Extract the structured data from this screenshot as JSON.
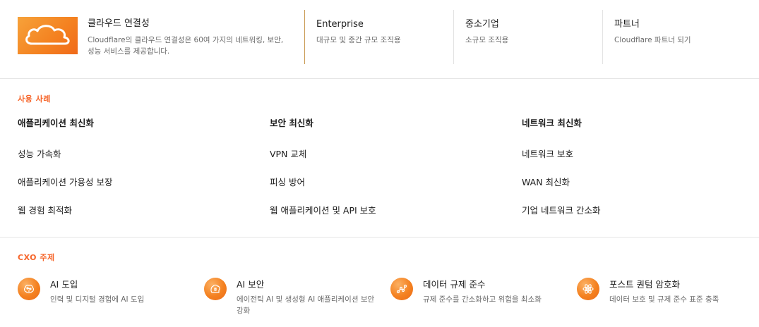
{
  "hero": {
    "title": "클라우드 연결성",
    "desc": "Cloudflare의 클라우드 연결성은 60여 가지의 네트워킹, 보안, 성능 서비스를 제공합니다.",
    "icon": "cloud-icon"
  },
  "columns": [
    {
      "title": "Enterprise",
      "sub": "대규모 및 중간 규모 조직용"
    },
    {
      "title": "중소기업",
      "sub": "소규모 조직용"
    },
    {
      "title": "파트너",
      "sub": "Cloudflare 파트너 되기"
    }
  ],
  "use_cases": {
    "label": "사용 사례",
    "columns": [
      {
        "head": "애플리케이션 최신화",
        "items": [
          "성능 가속화",
          "애플리케이션 가용성 보장",
          "웹 경험 최적화"
        ]
      },
      {
        "head": "보안 최신화",
        "items": [
          "VPN 교체",
          "피싱 방어",
          "웹 애플리케이션 및 API 보호"
        ]
      },
      {
        "head": "네트워크 최신화",
        "items": [
          "네트워크 보호",
          "WAN 최신화",
          "기업 네트워크 간소화"
        ]
      }
    ]
  },
  "cxo": {
    "label": "CXO 주제",
    "items": [
      {
        "title": "AI 도입",
        "desc": "인력 및 디지털 경험에 AI 도입",
        "icon": "ai-brain-icon"
      },
      {
        "title": "AI 보안",
        "desc": "에이전틱 AI 및 생성형 AI 애플리케이션 보안 강화",
        "icon": "ai-security-icon"
      },
      {
        "title": "데이터 규제 준수",
        "desc": "규제 준수를 간소화하고 위험을 최소화",
        "icon": "data-compliance-icon"
      },
      {
        "title": "포스트 퀀텀 암호화",
        "desc": "데이터 보호 및 규제 준수 표준 충족",
        "icon": "atom-icon"
      }
    ]
  },
  "colors": {
    "accent": "#f6652a",
    "brand_orange": "#f48120"
  }
}
